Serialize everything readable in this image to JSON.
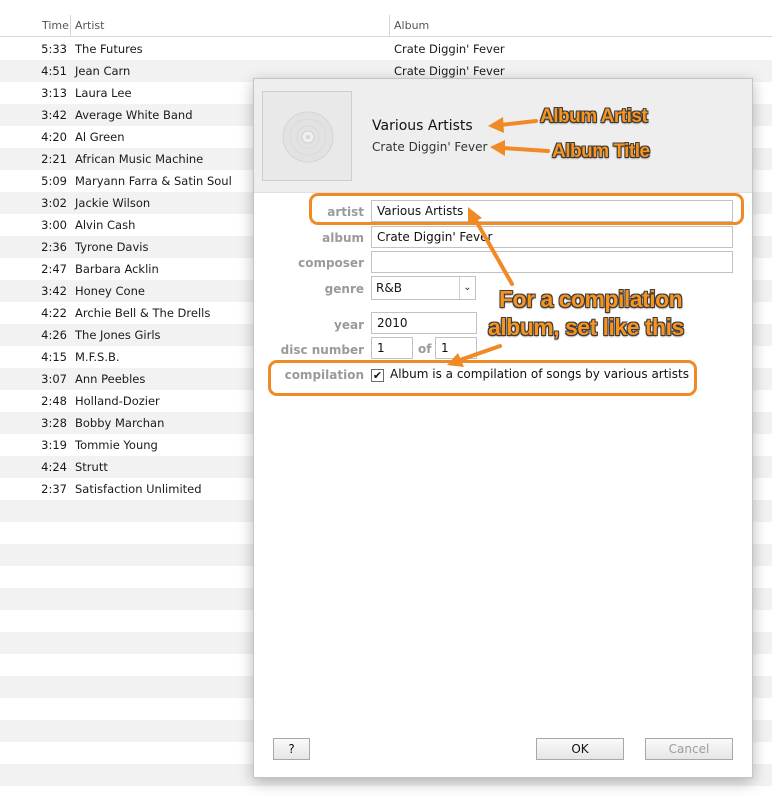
{
  "list": {
    "headers": {
      "time": "Time",
      "artist": "Artist",
      "album": "Album"
    },
    "rows": [
      {
        "time": "5:33",
        "artist": "The Futures",
        "album": "Crate Diggin' Fever"
      },
      {
        "time": "4:51",
        "artist": "Jean Carn",
        "album": "Crate Diggin' Fever"
      },
      {
        "time": "3:13",
        "artist": "Laura Lee",
        "album": ""
      },
      {
        "time": "3:42",
        "artist": "Average White Band",
        "album": ""
      },
      {
        "time": "4:20",
        "artist": "Al Green",
        "album": ""
      },
      {
        "time": "2:21",
        "artist": "African Music Machine",
        "album": ""
      },
      {
        "time": "5:09",
        "artist": "Maryann Farra & Satin Soul",
        "album": ""
      },
      {
        "time": "3:02",
        "artist": "Jackie Wilson",
        "album": ""
      },
      {
        "time": "3:00",
        "artist": "Alvin Cash",
        "album": ""
      },
      {
        "time": "2:36",
        "artist": "Tyrone Davis",
        "album": ""
      },
      {
        "time": "2:47",
        "artist": "Barbara Acklin",
        "album": ""
      },
      {
        "time": "3:42",
        "artist": "Honey Cone",
        "album": ""
      },
      {
        "time": "4:22",
        "artist": "Archie Bell & The Drells",
        "album": ""
      },
      {
        "time": "4:26",
        "artist": "The Jones Girls",
        "album": ""
      },
      {
        "time": "4:15",
        "artist": "M.F.S.B.",
        "album": ""
      },
      {
        "time": "3:07",
        "artist": "Ann Peebles",
        "album": ""
      },
      {
        "time": "2:48",
        "artist": "Holland-Dozier",
        "album": ""
      },
      {
        "time": "3:28",
        "artist": "Bobby Marchan",
        "album": ""
      },
      {
        "time": "3:19",
        "artist": "Tommie Young",
        "album": ""
      },
      {
        "time": "4:24",
        "artist": "Strutt",
        "album": ""
      },
      {
        "time": "2:37",
        "artist": "Satisfaction Unlimited",
        "album": ""
      }
    ],
    "empty_rows": 13
  },
  "dialog": {
    "header": {
      "artist": "Various Artists",
      "album": "Crate Diggin' Fever",
      "artwork_icon": "cd-icon"
    },
    "fields": {
      "artist": {
        "label": "artist",
        "value": "Various Artists"
      },
      "album": {
        "label": "album",
        "value": "Crate Diggin' Fever"
      },
      "composer": {
        "label": "composer",
        "value": ""
      },
      "genre": {
        "label": "genre",
        "value": "R&B"
      },
      "year": {
        "label": "year",
        "value": "2010"
      },
      "disc_number": {
        "label": "disc number",
        "value": "1",
        "of_label": "of",
        "total": "1"
      },
      "compilation": {
        "label": "compilation",
        "checked": true,
        "checkbox_label": "Album is a compilation of songs by various artists"
      }
    },
    "buttons": {
      "help": "?",
      "ok": "OK",
      "cancel": "Cancel"
    }
  },
  "annotations": {
    "album_artist": "Album Artist",
    "album_title": "Album Title",
    "compilation_note_line1": "For a compilation",
    "compilation_note_line2": "album, set like this",
    "accent_color": "#f7931e"
  }
}
